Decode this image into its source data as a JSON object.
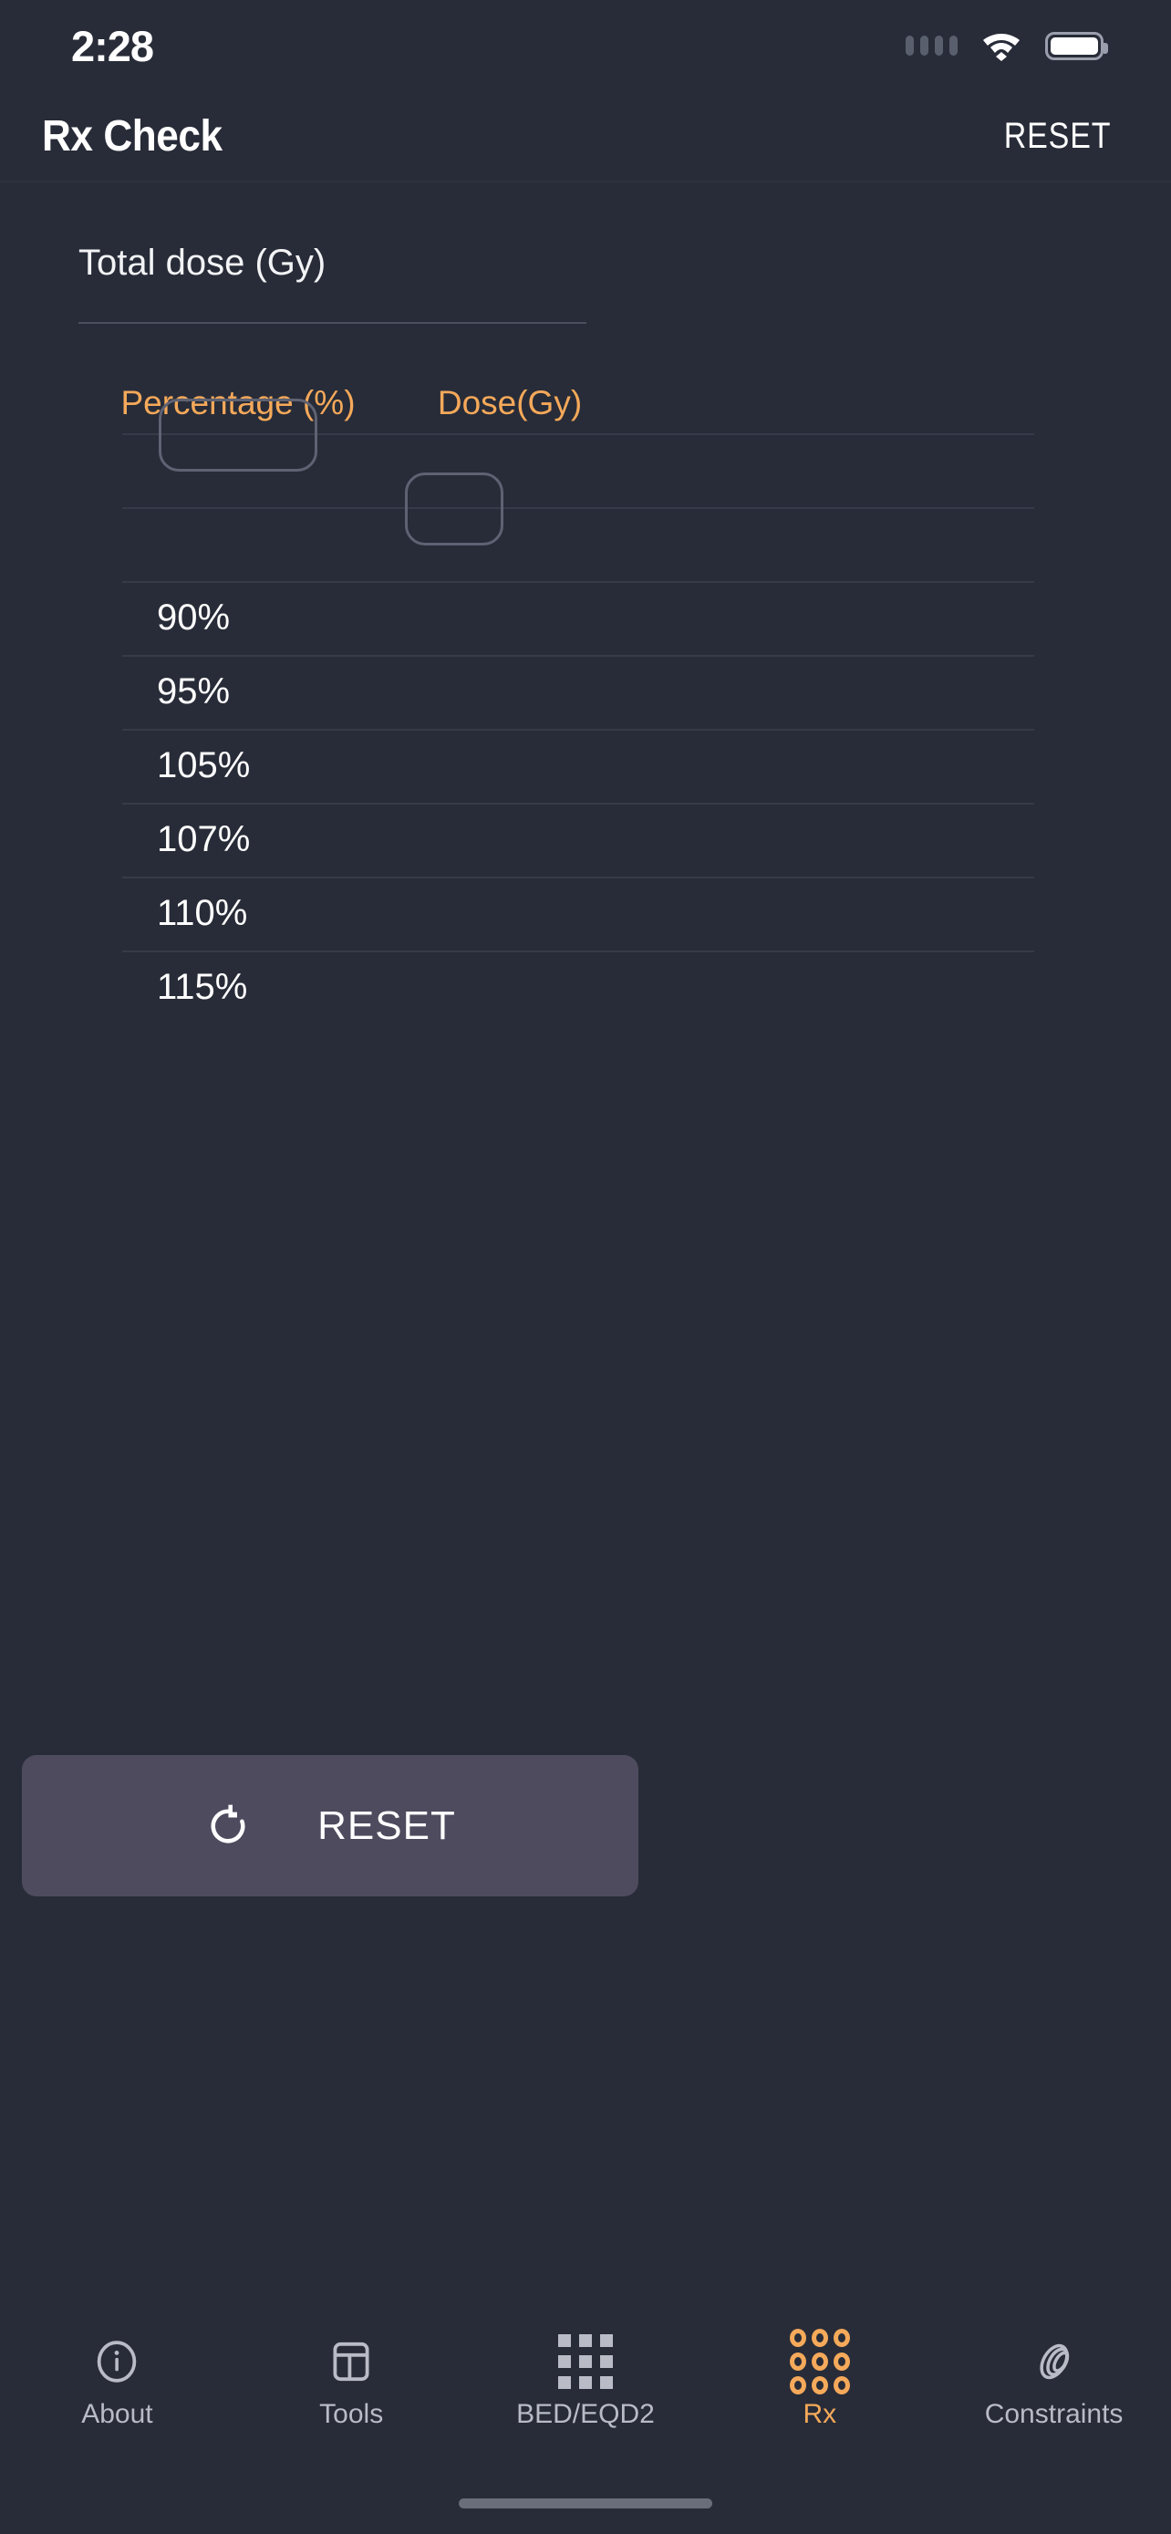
{
  "status_bar": {
    "time": "2:28",
    "signal_icon": "signal-dots-icon",
    "wifi_icon": "wifi-icon",
    "battery_icon": "battery-icon"
  },
  "header": {
    "title": "Rx Check",
    "reset_label": "RESET"
  },
  "form": {
    "total_dose_label": "Total dose (Gy)",
    "total_dose_value": "",
    "total_dose_placeholder": ""
  },
  "table": {
    "columns": [
      {
        "key": "percentage",
        "label": "Percentage (%)"
      },
      {
        "key": "dose",
        "label": "Dose(Gy)"
      }
    ],
    "input_rows": [
      {
        "percentage_value": "",
        "dose_value": "",
        "active_field": "percentage"
      },
      {
        "percentage_value": "",
        "dose_value": "",
        "active_field": "dose"
      }
    ],
    "rows": [
      {
        "percentage": "90%",
        "dose": ""
      },
      {
        "percentage": "95%",
        "dose": ""
      },
      {
        "percentage": "105%",
        "dose": ""
      },
      {
        "percentage": "107%",
        "dose": ""
      },
      {
        "percentage": "110%",
        "dose": ""
      },
      {
        "percentage": "115%",
        "dose": ""
      }
    ]
  },
  "reset_button": {
    "label": "RESET",
    "icon": "refresh-icon"
  },
  "tabbar": {
    "items": [
      {
        "label": "About",
        "icon": "info-circle-icon",
        "active": false
      },
      {
        "label": "Tools",
        "icon": "layout-panel-icon",
        "active": false
      },
      {
        "label": "BED/EQD2",
        "icon": "grid-3x3-icon",
        "active": false
      },
      {
        "label": "Rx",
        "icon": "pills-grid-icon",
        "active": true
      },
      {
        "label": "Constraints",
        "icon": "rings-icon",
        "active": false
      }
    ]
  },
  "colors": {
    "background": "#282c38",
    "accent": "#f5a95a",
    "text": "#ffffff",
    "muted": "#b9bcc6",
    "divider": "#363b49",
    "button": "#4e4b5e",
    "input_border": "#5e6273"
  }
}
